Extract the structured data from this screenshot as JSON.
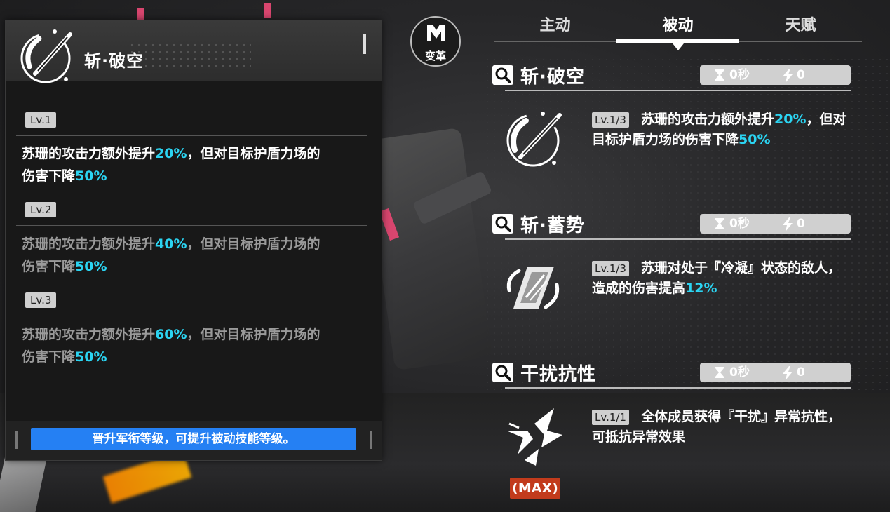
{
  "panel": {
    "title": "斩·破空",
    "levels": [
      {
        "badge": "Lv.1",
        "pre": "苏珊的攻击力额外提升",
        "val": "20%",
        "mid": "，但对目标护盾力场的",
        "line2": "伤害下降",
        "val2": "50%"
      },
      {
        "badge": "Lv.2",
        "pre": "苏珊的攻击力额外提升",
        "val": "40%",
        "mid": "，但对目标护盾力场的",
        "line2": "伤害下降",
        "val2": "50%"
      },
      {
        "badge": "Lv.3",
        "pre": "苏珊的攻击力额外提升",
        "val": "60%",
        "mid": "，但对目标护盾力场的",
        "line2": "伤害下降",
        "val2": "50%"
      }
    ],
    "footer_button": "晋升军衔等级，可提升被动技能等级。"
  },
  "reform_button": {
    "label": "变革"
  },
  "tabs": [
    {
      "label": "主动"
    },
    {
      "label": "被动"
    },
    {
      "label": "天赋"
    }
  ],
  "active_tab": "被动",
  "skills": [
    {
      "title": "斩·破空",
      "cooldown": "0秒",
      "energy": "0",
      "badge": "Lv.1/3",
      "desc_a": "苏珊的攻击力额外提升",
      "desc_hl": "20%",
      "desc_b": "，但对目标护盾力场的伤害下降",
      "desc_hl2": "50%"
    },
    {
      "title": "斩·蓄势",
      "cooldown": "0秒",
      "energy": "0",
      "badge": "Lv.1/3",
      "desc_a": "苏珊对处于『冷凝』状态的敌人，造成的伤害提高",
      "desc_hl": "12%"
    },
    {
      "title": "干扰抗性",
      "cooldown": "0秒",
      "energy": "0",
      "badge": "Lv.1/1",
      "desc_a": "全体成员获得『干扰』异常抗性，可抵抗异常效果",
      "max_tag": "(MAX)"
    }
  ],
  "colors": {
    "highlight": "#2bd4f2",
    "promo_button": "#2580f3",
    "max_tag": "#c23b1c"
  }
}
